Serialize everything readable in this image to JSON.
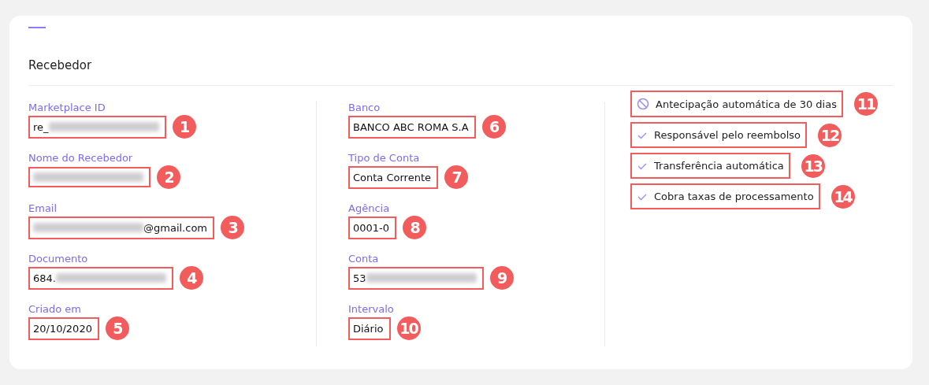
{
  "section": {
    "title": "Recebedor"
  },
  "columns": [
    {
      "fields": [
        {
          "label": "Marketplace ID",
          "value": {
            "prefix": "re_",
            "redacted": true
          },
          "marker": "1"
        },
        {
          "label": "Nome do Recebedor",
          "value": {
            "redacted": true
          },
          "marker": "2"
        },
        {
          "label": "Email",
          "value": {
            "redacted": true,
            "suffix": "@gmail.com"
          },
          "marker": "3"
        },
        {
          "label": "Documento",
          "value": {
            "prefix": "684.",
            "redacted": true
          },
          "marker": "4"
        },
        {
          "label": "Criado em",
          "value": {
            "prefix": "20/10/2020",
            "redacted": false
          },
          "marker": "5"
        }
      ]
    },
    {
      "fields": [
        {
          "label": "Banco",
          "value": {
            "prefix": "BANCO ABC ROMA S.A",
            "redacted": false
          },
          "marker": "6"
        },
        {
          "label": "Tipo de Conta",
          "value": {
            "prefix": "Conta Corrente",
            "redacted": false
          },
          "marker": "7"
        },
        {
          "label": "Agência",
          "value": {
            "prefix": "0001-0",
            "redacted": false
          },
          "marker": "8"
        },
        {
          "label": "Conta",
          "value": {
            "prefix": "53",
            "redacted": true
          },
          "marker": "9"
        },
        {
          "label": "Intervalo",
          "value": {
            "prefix": "Diário",
            "redacted": false
          },
          "marker": "10"
        }
      ]
    }
  ],
  "features": [
    {
      "label": "Antecipação automática de 30 dias",
      "kind": "disabled",
      "marker": "11"
    },
    {
      "label": "Responsável pelo reembolso",
      "kind": "enabled",
      "marker": "12"
    },
    {
      "label": "Transferência automática",
      "kind": "enabled",
      "marker": "13"
    },
    {
      "label": "Cobra taxas de processamento",
      "kind": "enabled",
      "marker": "14"
    }
  ]
}
